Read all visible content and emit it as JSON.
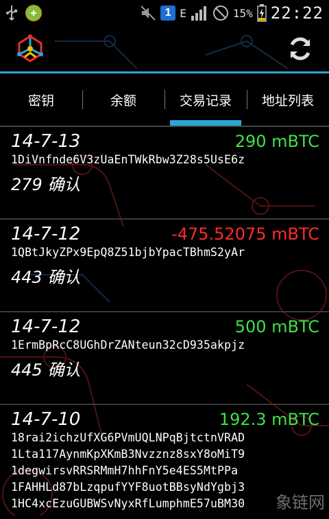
{
  "status_bar": {
    "battery_percent": "15%",
    "time": "22:22",
    "sim_badge": "1",
    "network_type": "E",
    "icons": [
      "usb-icon",
      "app-notification-icon",
      "mute-icon",
      "sim-icon",
      "data-arrows-icon",
      "signal-icon",
      "no-sim-icon",
      "battery-charging-icon"
    ]
  },
  "app_bar": {
    "logo_icon": "bitcoin-wallet-logo-icon",
    "refresh_icon": "refresh-icon"
  },
  "tabs": [
    {
      "label": "密钥",
      "active": false
    },
    {
      "label": "余额",
      "active": false
    },
    {
      "label": "交易记录",
      "active": true
    },
    {
      "label": "地址列表",
      "active": false
    }
  ],
  "transactions": [
    {
      "date": "14-7-13",
      "amount": "290 mBTC",
      "direction": "positive",
      "addresses": [
        "1DiVnfnde6V3zUaEnTWkRbw3Z28s5UsE6z"
      ],
      "confirmations": "279 确认"
    },
    {
      "date": "14-7-12",
      "amount": "-475.52075 mBTC",
      "direction": "negative",
      "addresses": [
        "1QBtJkyZPx9EpQ8Z51bjbYpacTBhmS2yAr"
      ],
      "confirmations": "443 确认"
    },
    {
      "date": "14-7-12",
      "amount": "500 mBTC",
      "direction": "positive",
      "addresses": [
        "1ErmBpRcC8UGhDrZANteun32cD935akpjz"
      ],
      "confirmations": "445 确认"
    },
    {
      "date": "14-7-10",
      "amount": "192.3 mBTC",
      "direction": "positive",
      "addresses": [
        "18rai2ichzUfXG6PVmUQLNPqBjtctnVRAD",
        "1Lta117AynmKpXKmB3Nvzznz8sxY8oMiT9",
        "1degwirsvRRSRMmH7hhFnY5e4ES5MtPPa",
        "1FAHHLd87bLzqpufYYF8uotBBsyNdYgbj3",
        "1HC4xcEzuGUBWSvNyxRfLumphmE57uBM30"
      ],
      "confirmations": ""
    }
  ],
  "colors": {
    "accent": "#2aa7d6",
    "positive": "#3ee24a",
    "negative": "#ff2a2a",
    "background": "#000000"
  },
  "watermark": "象链网"
}
